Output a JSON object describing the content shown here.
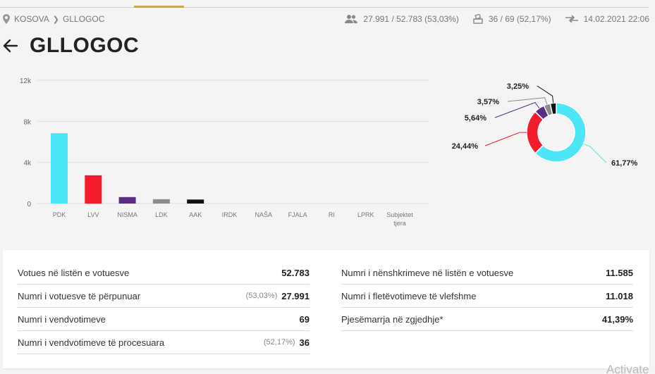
{
  "breadcrumb": {
    "root": "KOSOVA",
    "current": "GLLOGOC"
  },
  "header_stats": {
    "voters": "27.991 / 52.783 (53,03%)",
    "stations": "36 / 69 (52,17%)",
    "updated": "14.02.2021 22:06"
  },
  "title": "GLLOGOC",
  "chart_data": [
    {
      "type": "bar",
      "categories": [
        "PDK",
        "LVV",
        "NISMA",
        "LDK",
        "AAK",
        "IRDK",
        "NAŠA",
        "FJALA",
        "RI",
        "LPRK",
        "Subjektet tjera"
      ],
      "values": [
        6850,
        2750,
        630,
        420,
        390,
        0,
        0,
        0,
        0,
        0,
        0
      ],
      "colors": [
        "#4de6f7",
        "#f21c2b",
        "#5a2d82",
        "#8c8c8c",
        "#111111",
        "#cccccc",
        "#cccccc",
        "#cccccc",
        "#cccccc",
        "#cccccc",
        "#cccccc"
      ],
      "ylim": [
        0,
        12000
      ],
      "yticks": [
        "0",
        "4k",
        "8k",
        "12k"
      ],
      "grid": true
    },
    {
      "type": "pie",
      "slices": [
        {
          "label": "61,77%",
          "value": 61.77,
          "color": "#4de6f7"
        },
        {
          "label": "24,44%",
          "value": 24.44,
          "color": "#f21c2b"
        },
        {
          "label": "5,64%",
          "value": 5.64,
          "color": "#5a2d82"
        },
        {
          "label": "3,57%",
          "value": 3.57,
          "color": "#8c8c8c"
        },
        {
          "label": "3,25%",
          "value": 3.25,
          "color": "#111111"
        }
      ]
    }
  ],
  "summary": {
    "left": [
      {
        "label": "Votues në listën e votuesve",
        "pct": "",
        "value": "52.783"
      },
      {
        "label": "Numri i votuesve të përpunuar",
        "pct": "(53,03%)",
        "value": "27.991"
      },
      {
        "label": "Numri i vendvotimeve",
        "pct": "",
        "value": "69"
      },
      {
        "label": "Numri i vendvotimeve të procesuara",
        "pct": "(52,17%)",
        "value": "36"
      }
    ],
    "right": [
      {
        "label": "Numri i nënshkrimeve në listën e votuesve",
        "value": "11.585"
      },
      {
        "label": "Numri i fletëvotimeve të vlefshme",
        "value": "11.018"
      },
      {
        "label": "Pjesëmarrja në zgjedhje*",
        "value": "41,39%"
      }
    ]
  },
  "watermark": "Activate"
}
